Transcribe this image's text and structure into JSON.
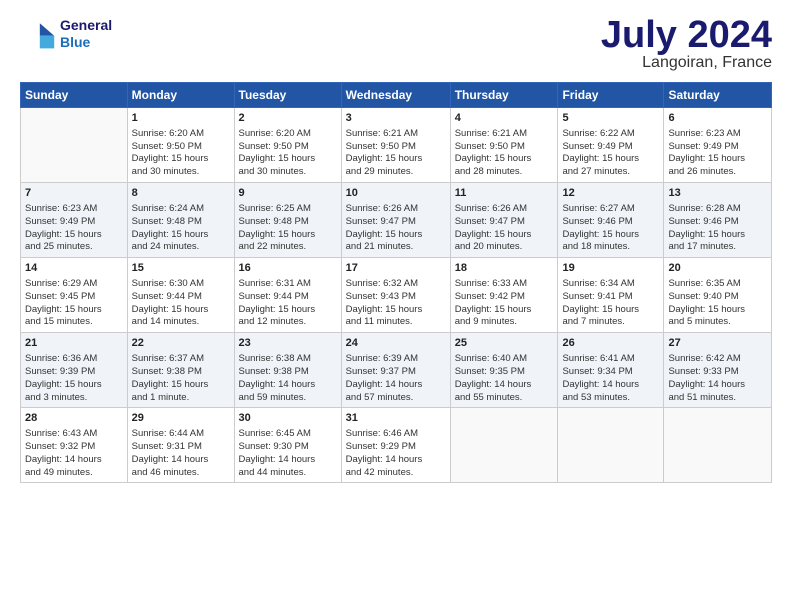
{
  "header": {
    "logo_line1": "General",
    "logo_line2": "Blue",
    "main_title": "July 2024",
    "subtitle": "Langoiran, France"
  },
  "weekdays": [
    "Sunday",
    "Monday",
    "Tuesday",
    "Wednesday",
    "Thursday",
    "Friday",
    "Saturday"
  ],
  "rows": [
    [
      {
        "day": "",
        "lines": []
      },
      {
        "day": "1",
        "lines": [
          "Sunrise: 6:20 AM",
          "Sunset: 9:50 PM",
          "Daylight: 15 hours",
          "and 30 minutes."
        ]
      },
      {
        "day": "2",
        "lines": [
          "Sunrise: 6:20 AM",
          "Sunset: 9:50 PM",
          "Daylight: 15 hours",
          "and 30 minutes."
        ]
      },
      {
        "day": "3",
        "lines": [
          "Sunrise: 6:21 AM",
          "Sunset: 9:50 PM",
          "Daylight: 15 hours",
          "and 29 minutes."
        ]
      },
      {
        "day": "4",
        "lines": [
          "Sunrise: 6:21 AM",
          "Sunset: 9:50 PM",
          "Daylight: 15 hours",
          "and 28 minutes."
        ]
      },
      {
        "day": "5",
        "lines": [
          "Sunrise: 6:22 AM",
          "Sunset: 9:49 PM",
          "Daylight: 15 hours",
          "and 27 minutes."
        ]
      },
      {
        "day": "6",
        "lines": [
          "Sunrise: 6:23 AM",
          "Sunset: 9:49 PM",
          "Daylight: 15 hours",
          "and 26 minutes."
        ]
      }
    ],
    [
      {
        "day": "7",
        "lines": [
          "Sunrise: 6:23 AM",
          "Sunset: 9:49 PM",
          "Daylight: 15 hours",
          "and 25 minutes."
        ]
      },
      {
        "day": "8",
        "lines": [
          "Sunrise: 6:24 AM",
          "Sunset: 9:48 PM",
          "Daylight: 15 hours",
          "and 24 minutes."
        ]
      },
      {
        "day": "9",
        "lines": [
          "Sunrise: 6:25 AM",
          "Sunset: 9:48 PM",
          "Daylight: 15 hours",
          "and 22 minutes."
        ]
      },
      {
        "day": "10",
        "lines": [
          "Sunrise: 6:26 AM",
          "Sunset: 9:47 PM",
          "Daylight: 15 hours",
          "and 21 minutes."
        ]
      },
      {
        "day": "11",
        "lines": [
          "Sunrise: 6:26 AM",
          "Sunset: 9:47 PM",
          "Daylight: 15 hours",
          "and 20 minutes."
        ]
      },
      {
        "day": "12",
        "lines": [
          "Sunrise: 6:27 AM",
          "Sunset: 9:46 PM",
          "Daylight: 15 hours",
          "and 18 minutes."
        ]
      },
      {
        "day": "13",
        "lines": [
          "Sunrise: 6:28 AM",
          "Sunset: 9:46 PM",
          "Daylight: 15 hours",
          "and 17 minutes."
        ]
      }
    ],
    [
      {
        "day": "14",
        "lines": [
          "Sunrise: 6:29 AM",
          "Sunset: 9:45 PM",
          "Daylight: 15 hours",
          "and 15 minutes."
        ]
      },
      {
        "day": "15",
        "lines": [
          "Sunrise: 6:30 AM",
          "Sunset: 9:44 PM",
          "Daylight: 15 hours",
          "and 14 minutes."
        ]
      },
      {
        "day": "16",
        "lines": [
          "Sunrise: 6:31 AM",
          "Sunset: 9:44 PM",
          "Daylight: 15 hours",
          "and 12 minutes."
        ]
      },
      {
        "day": "17",
        "lines": [
          "Sunrise: 6:32 AM",
          "Sunset: 9:43 PM",
          "Daylight: 15 hours",
          "and 11 minutes."
        ]
      },
      {
        "day": "18",
        "lines": [
          "Sunrise: 6:33 AM",
          "Sunset: 9:42 PM",
          "Daylight: 15 hours",
          "and 9 minutes."
        ]
      },
      {
        "day": "19",
        "lines": [
          "Sunrise: 6:34 AM",
          "Sunset: 9:41 PM",
          "Daylight: 15 hours",
          "and 7 minutes."
        ]
      },
      {
        "day": "20",
        "lines": [
          "Sunrise: 6:35 AM",
          "Sunset: 9:40 PM",
          "Daylight: 15 hours",
          "and 5 minutes."
        ]
      }
    ],
    [
      {
        "day": "21",
        "lines": [
          "Sunrise: 6:36 AM",
          "Sunset: 9:39 PM",
          "Daylight: 15 hours",
          "and 3 minutes."
        ]
      },
      {
        "day": "22",
        "lines": [
          "Sunrise: 6:37 AM",
          "Sunset: 9:38 PM",
          "Daylight: 15 hours",
          "and 1 minute."
        ]
      },
      {
        "day": "23",
        "lines": [
          "Sunrise: 6:38 AM",
          "Sunset: 9:38 PM",
          "Daylight: 14 hours",
          "and 59 minutes."
        ]
      },
      {
        "day": "24",
        "lines": [
          "Sunrise: 6:39 AM",
          "Sunset: 9:37 PM",
          "Daylight: 14 hours",
          "and 57 minutes."
        ]
      },
      {
        "day": "25",
        "lines": [
          "Sunrise: 6:40 AM",
          "Sunset: 9:35 PM",
          "Daylight: 14 hours",
          "and 55 minutes."
        ]
      },
      {
        "day": "26",
        "lines": [
          "Sunrise: 6:41 AM",
          "Sunset: 9:34 PM",
          "Daylight: 14 hours",
          "and 53 minutes."
        ]
      },
      {
        "day": "27",
        "lines": [
          "Sunrise: 6:42 AM",
          "Sunset: 9:33 PM",
          "Daylight: 14 hours",
          "and 51 minutes."
        ]
      }
    ],
    [
      {
        "day": "28",
        "lines": [
          "Sunrise: 6:43 AM",
          "Sunset: 9:32 PM",
          "Daylight: 14 hours",
          "and 49 minutes."
        ]
      },
      {
        "day": "29",
        "lines": [
          "Sunrise: 6:44 AM",
          "Sunset: 9:31 PM",
          "Daylight: 14 hours",
          "and 46 minutes."
        ]
      },
      {
        "day": "30",
        "lines": [
          "Sunrise: 6:45 AM",
          "Sunset: 9:30 PM",
          "Daylight: 14 hours",
          "and 44 minutes."
        ]
      },
      {
        "day": "31",
        "lines": [
          "Sunrise: 6:46 AM",
          "Sunset: 9:29 PM",
          "Daylight: 14 hours",
          "and 42 minutes."
        ]
      },
      {
        "day": "",
        "lines": []
      },
      {
        "day": "",
        "lines": []
      },
      {
        "day": "",
        "lines": []
      }
    ]
  ]
}
